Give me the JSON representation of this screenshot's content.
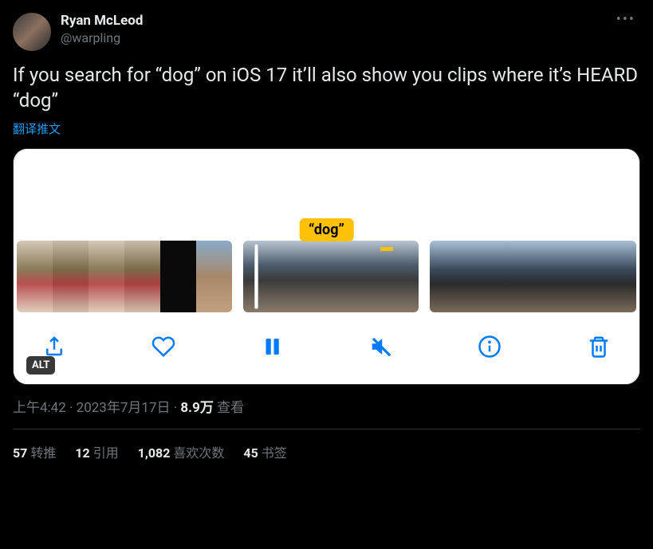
{
  "user": {
    "display_name": "Ryan McLeod",
    "username": "@warpling"
  },
  "tweet": {
    "text": "If you search for “dog” on iOS 17 it’ll also show you clips where it’s HEARD “dog”",
    "translate_label": "翻译推文"
  },
  "media": {
    "search_badge": "“dog”",
    "alt_label": "ALT"
  },
  "meta": {
    "time": "上午4:42",
    "dot1": " · ",
    "date": "2023年7月17日",
    "dot2": " · ",
    "views_count": "8.9万",
    "views_label": " 查看"
  },
  "stats": {
    "retweets": {
      "count": "57",
      "label": "转推"
    },
    "quotes": {
      "count": "12",
      "label": "引用"
    },
    "likes": {
      "count": "1,082",
      "label": "喜欢次数"
    },
    "bookmarks": {
      "count": "45",
      "label": "书签"
    }
  }
}
